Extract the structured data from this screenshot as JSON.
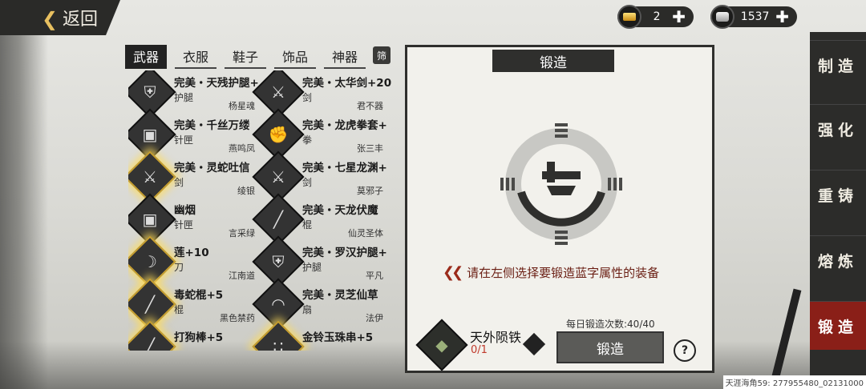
{
  "header": {
    "back_label": "返回",
    "gold": {
      "icon": "gold-ingot-icon",
      "value": "2"
    },
    "silver": {
      "icon": "silver-ingot-icon",
      "value": "1537"
    }
  },
  "tabs": [
    "武器",
    "衣服",
    "鞋子",
    "饰品",
    "神器"
  ],
  "active_tab": "武器",
  "filter_label": "筛",
  "items": [
    {
      "name": "完美・天残护腿+",
      "type": "护腿",
      "owner": "杨星魂",
      "icon": "leg-armor-icon",
      "glow": false
    },
    {
      "name": "完美・太华剑+20",
      "type": "剑",
      "owner": "君不器",
      "icon": "sword-icon",
      "glow": false
    },
    {
      "name": "完美・千丝万缕",
      "type": "针匣",
      "owner": "燕鸣凤",
      "icon": "needle-box-icon",
      "glow": false
    },
    {
      "name": "完美・龙虎拳套+",
      "type": "拳",
      "owner": "张三丰",
      "icon": "fist-gauntlet-icon",
      "glow": false
    },
    {
      "name": "完美・灵蛇吐信",
      "type": "剑",
      "owner": "绫银",
      "icon": "sword-icon",
      "glow": true
    },
    {
      "name": "完美・七星龙渊+",
      "type": "剑",
      "owner": "莫邪子",
      "icon": "sword-icon",
      "glow": false
    },
    {
      "name": "幽烟",
      "type": "针匣",
      "owner": "言采绿",
      "icon": "needle-box-icon",
      "glow": false
    },
    {
      "name": "完美・天龙伏魔",
      "type": "棍",
      "owner": "仙灵圣体",
      "icon": "staff-icon",
      "glow": false
    },
    {
      "name": "莲+10",
      "type": "刀",
      "owner": "江南道",
      "icon": "blade-icon",
      "glow": true
    },
    {
      "name": "完美・罗汉护腿+",
      "type": "护腿",
      "owner": "平凡",
      "icon": "leg-armor-icon",
      "glow": false
    },
    {
      "name": "毒蛇棍+5",
      "type": "棍",
      "owner": "黑色禁药",
      "icon": "staff-icon",
      "glow": true
    },
    {
      "name": "完美・灵芝仙草",
      "type": "扇",
      "owner": "法伊",
      "icon": "fan-icon",
      "glow": false
    },
    {
      "name": "打狗棒+5",
      "type": "",
      "owner": "",
      "icon": "staff-icon",
      "glow": true
    },
    {
      "name": "金铃玉珠串+5",
      "type": "",
      "owner": "",
      "icon": "bead-string-icon",
      "glow": true
    }
  ],
  "forge": {
    "title": "锻造",
    "hint": "请在左侧选择要锻造蓝字属性的装备",
    "material_name": "天外陨铁",
    "material_count": "0/1",
    "daily_count": "每日锻造次数:40/40",
    "button_label": "锻造",
    "help_label": "?"
  },
  "nav": [
    {
      "label": "制造",
      "active": false
    },
    {
      "label": "强化",
      "active": false
    },
    {
      "label": "重铸",
      "active": false
    },
    {
      "label": "熔炼",
      "active": false
    },
    {
      "label": "锻造",
      "active": true
    }
  ],
  "watermark": "天涯海角59: 277955480_02131000"
}
